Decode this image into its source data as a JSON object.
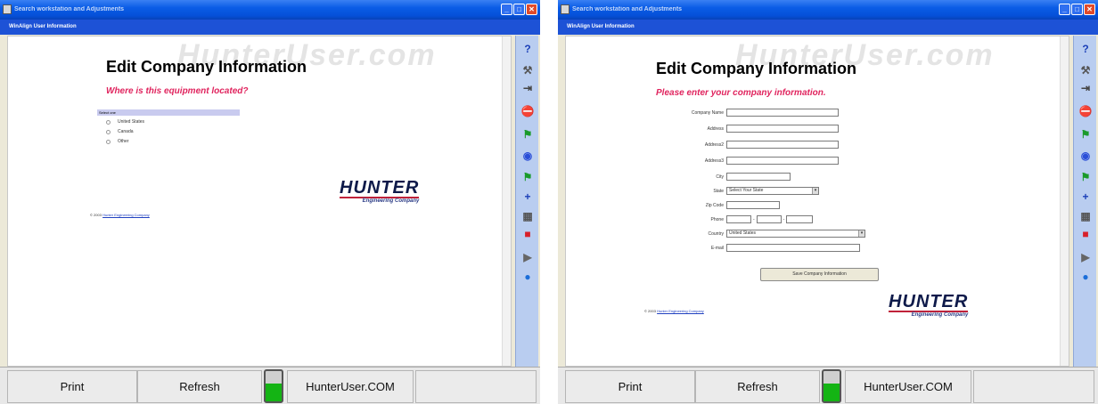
{
  "windows": [
    {
      "title": "Search workstation and Adjustments",
      "subtitle": "WinAlign User Information",
      "watermark": "HunterUser.com",
      "heading": "Edit Company Information",
      "subheading": "Where is this equipment located?",
      "select_header": "Select one",
      "options": [
        "United States",
        "Canada",
        "Other"
      ],
      "copyright_prefix": "© 2003",
      "copyright_link": "Hunter Engineering Company",
      "logo_word": "HUNTER",
      "logo_sub": "Engineering Company"
    },
    {
      "title": "Search workstation and Adjustments",
      "subtitle": "WinAlign User Information",
      "watermark": "HunterUser.com",
      "heading": "Edit Company Information",
      "subheading": "Please enter your company information.",
      "fields": {
        "company_name": "Company Name",
        "address": "Address",
        "address2": "Address2",
        "address3": "Address3",
        "city": "City",
        "state": "State",
        "state_value": "Select Your State",
        "zip": "Zip Code",
        "phone": "Phone",
        "country": "Country",
        "country_value": "United States",
        "email": "E-mail"
      },
      "save_button": "Save Company Information",
      "copyright_prefix": "© 2003",
      "copyright_link": "Hunter Engineering Company",
      "logo_word": "HUNTER",
      "logo_sub": "Engineering Company"
    }
  ],
  "bottom_bar": {
    "print": "Print",
    "refresh": "Refresh",
    "hunteruser": "HunterUser.COM",
    "progress_fraction": 0.6
  },
  "titlebar_buttons": [
    "_",
    "□",
    "✕"
  ],
  "toolbar_icons": [
    "help-question-icon",
    "tools-icon",
    "skip-step-icon",
    "stop-icon",
    "flags-icon",
    "target-icon",
    "flags-icon",
    "plus-icon",
    "calculator-icon",
    "red-cube-icon",
    "gun-icon",
    "globe-icon"
  ],
  "colors": {
    "accent_red": "#e0245e",
    "titlebar_blue": "#0550d8",
    "toolbar_bg": "#b9cdf0",
    "progress_green": "#14b414"
  }
}
